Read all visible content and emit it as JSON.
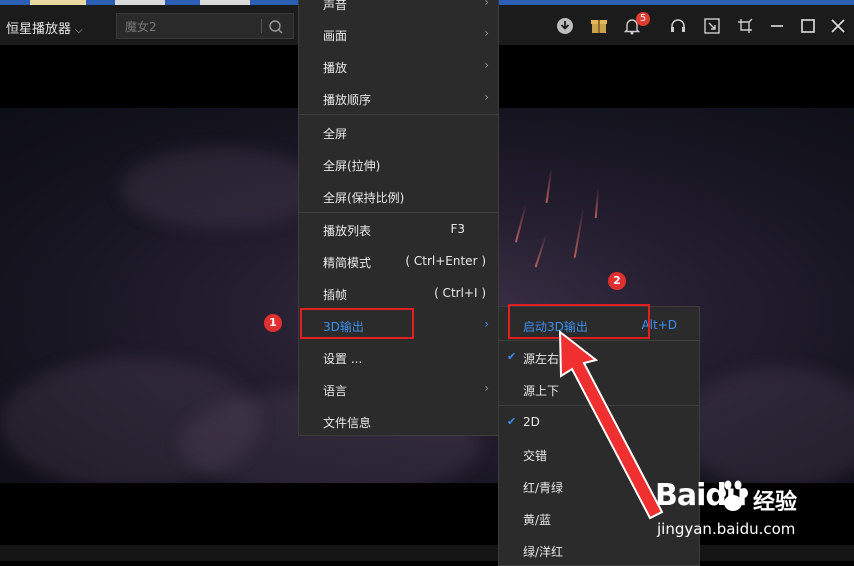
{
  "app": {
    "title": "恒星播放器"
  },
  "search": {
    "placeholder": "魔女2"
  },
  "notifications": {
    "count": "5"
  },
  "icons": [
    "download-icon",
    "gift-icon",
    "bell-icon",
    "headset-icon",
    "mini-mode-icon",
    "pin-icon",
    "minimize-icon",
    "maximize-icon",
    "close-icon"
  ],
  "context_menu": {
    "items_top": [
      {
        "label": "声音"
      },
      {
        "label": "画面"
      },
      {
        "label": "播放"
      },
      {
        "label": "播放顺序"
      }
    ],
    "items_fullscreen": [
      {
        "label": "全屏"
      },
      {
        "label": "全屏(拉伸)"
      },
      {
        "label": "全屏(保持比例)"
      }
    ],
    "items_mode": [
      {
        "label": "播放列表",
        "shortcut": "F3"
      },
      {
        "label": "精简模式",
        "shortcut": "( Ctrl+Enter )"
      },
      {
        "label": "插帧",
        "shortcut": "( Ctrl+I )"
      },
      {
        "label": "3D输出"
      },
      {
        "label": "设置 ..."
      },
      {
        "label": "语言"
      },
      {
        "label": "文件信息"
      }
    ]
  },
  "submenu_3d": {
    "start": {
      "label": "启动3D输出",
      "shortcut": "Alt+D"
    },
    "source": [
      {
        "label": "源左右",
        "checked": true
      },
      {
        "label": "源上下",
        "checked": false
      }
    ],
    "output": [
      {
        "label": "2D",
        "checked": true
      },
      {
        "label": "交错",
        "checked": false
      },
      {
        "label": "红/青绿",
        "checked": false
      },
      {
        "label": "黄/蓝",
        "checked": false
      },
      {
        "label": "绿/洋红",
        "checked": false
      }
    ]
  },
  "annotations": {
    "step1": "1",
    "step2": "2"
  },
  "watermark": {
    "brand": "Baidu",
    "cn": "经验",
    "url": "jingyan.baidu.com"
  },
  "colors": {
    "accent": "#3b8ff0",
    "annotation_red": "#e02020",
    "menu_bg": "#2b2b2b"
  }
}
